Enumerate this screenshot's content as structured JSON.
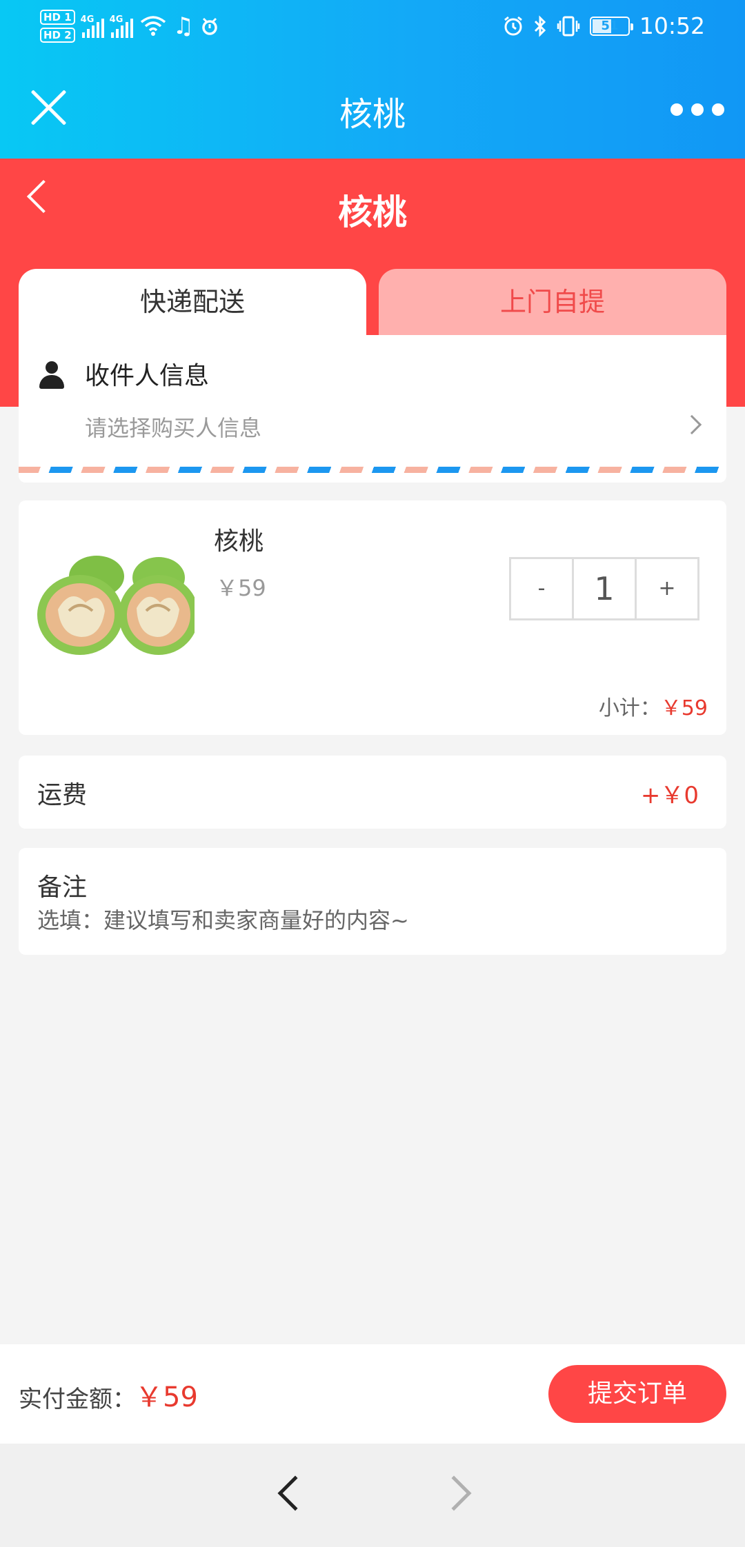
{
  "status_bar": {
    "sim1": "HD 1",
    "sim2": "HD 2",
    "network1": "4G",
    "network2": "4G",
    "battery": "51",
    "time": "10:52",
    "icons_left": [
      "wifi-icon",
      "music-icon",
      "notification-icon"
    ],
    "icons_right": [
      "alarm-icon",
      "bluetooth-icon",
      "vibrate-icon"
    ]
  },
  "app_bar": {
    "title": "核桃",
    "close_icon": "close-icon",
    "more_icon": "more-icon"
  },
  "page": {
    "title": "核桃",
    "back_icon": "chevron-left-icon"
  },
  "tabs": [
    {
      "label": "快递配送",
      "active": true
    },
    {
      "label": "上门自提",
      "active": false
    }
  ],
  "recipient": {
    "title": "收件人信息",
    "hint": "请选择购买人信息"
  },
  "product": {
    "name": "核桃",
    "price": "￥59",
    "quantity": "1",
    "minus_label": "-",
    "plus_label": "+",
    "subtotal_label": "小计：",
    "subtotal_value": "￥59"
  },
  "shipping": {
    "label": "运费",
    "value": "+￥0"
  },
  "remark": {
    "title": "备注",
    "placeholder": "选填：建议填写和卖家商量好的内容~"
  },
  "footer": {
    "pay_label": "实付金额：",
    "pay_amount": "￥59",
    "submit_label": "提交订单"
  },
  "colors": {
    "primary_red": "#ff4646",
    "price_red": "#e83a2f",
    "header_blue": "#13a9f7",
    "inactive_tab": "#ffb0ae"
  }
}
